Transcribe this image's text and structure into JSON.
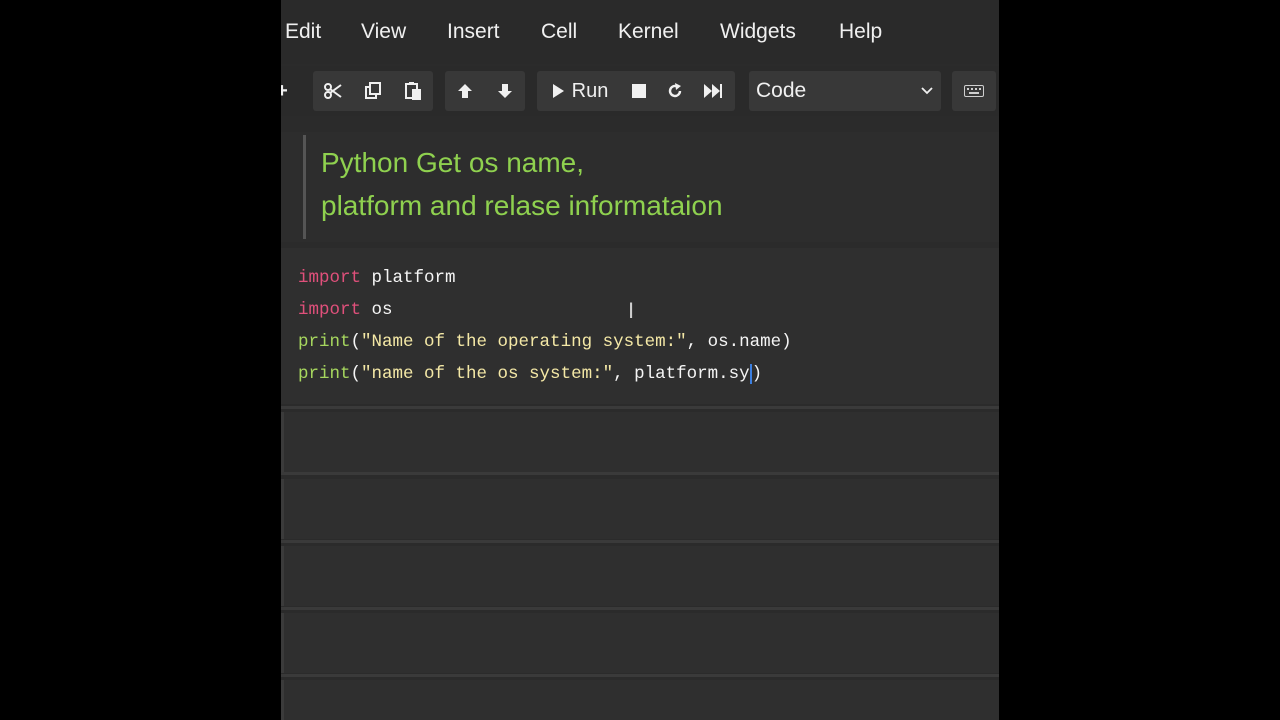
{
  "menu": [
    "Edit",
    "View",
    "Insert",
    "Cell",
    "Kernel",
    "Widgets",
    "Help"
  ],
  "toolbar": {
    "run_label": "Run",
    "cell_type": "Code",
    "icons": [
      "add-icon",
      "cut-icon",
      "copy-icon",
      "paste-icon",
      "move-up-icon",
      "move-down-icon",
      "run-icon",
      "stop-icon",
      "restart-icon",
      "run-all-icon",
      "keyboard-icon"
    ]
  },
  "markdown": {
    "line1": "Python Get os name,",
    "line2": "platform and relase informataion"
  },
  "code": {
    "l1_kw": "import",
    "l1_rest": " platform",
    "l2_kw": "import",
    "l2_rest": " os",
    "l3_fn": "print",
    "l3_open": "(",
    "l3_str": "\"Name of the operating system:\"",
    "l3_rest": ", os.name)",
    "l4_fn": "print",
    "l4_open": "(",
    "l4_str": "\"name of the os system:\"",
    "l4_rest": ", platform.sy",
    "l4_close": ")"
  },
  "colors": {
    "keyword": "#e0507b",
    "function": "#a6d65e",
    "string": "#f4e8a6",
    "markdown_heading": "#8fd14f"
  }
}
